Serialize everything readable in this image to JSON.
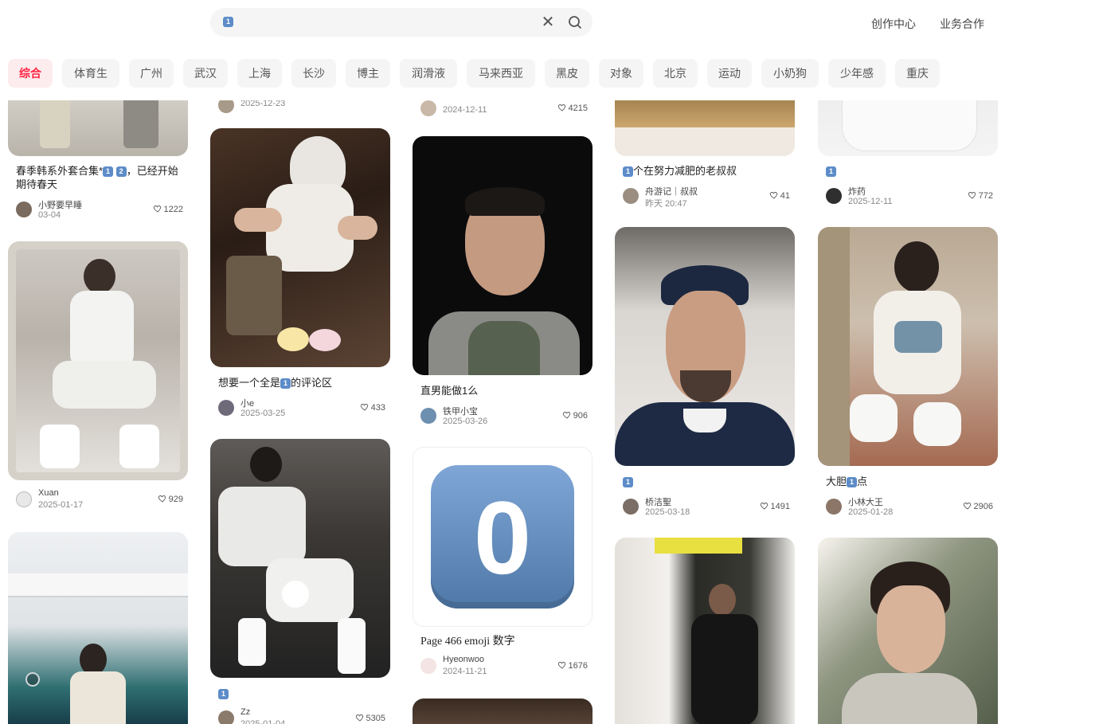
{
  "header": {
    "search_value": "1️⃣",
    "clear_icon": "close-icon",
    "search_icon": "search-icon",
    "links": [
      "创作中心",
      "业务合作"
    ]
  },
  "categories": {
    "items": [
      "综合",
      "体育生",
      "广州",
      "武汉",
      "上海",
      "长沙",
      "博主",
      "润滑液",
      "马来西亚",
      "黑皮",
      "对象",
      "北京",
      "运动",
      "小奶狗",
      "少年感",
      "重庆"
    ],
    "active": "综合"
  },
  "feed": {
    "col1": [
      {
        "title": "春季韩系外套合集*1️⃣2️⃣，已经开始期待春天",
        "author": "小野要早睡",
        "date": "03-04",
        "likes": "1222"
      },
      {
        "title": "",
        "author": "Xuan",
        "date": "2025-01-17",
        "likes": "929"
      },
      {
        "title": "",
        "author": "",
        "date": "",
        "likes": ""
      }
    ],
    "col2": [
      {
        "title": "",
        "author": "",
        "date": "2025-12-23",
        "likes": ""
      },
      {
        "title": "想要一个全是1️⃣的评论区",
        "author": "小e",
        "date": "2025-03-25",
        "likes": "433"
      },
      {
        "title": "1️⃣",
        "author": "Zz",
        "date": "2025-01-04",
        "likes": "5305"
      }
    ],
    "col3": [
      {
        "title": "",
        "author": "",
        "date": "2024-12-11",
        "likes": "4215"
      },
      {
        "title": "直男能做1么",
        "author": "铁甲小宝",
        "date": "2025-03-26",
        "likes": "906"
      },
      {
        "title": "Page 466 emoji 数字",
        "author": "Hyeonwoo",
        "date": "2024-11-21",
        "likes": "1676"
      }
    ],
    "col4": [
      {
        "title": "1️⃣个在努力减肥的老叔叔",
        "author": "舟游记｜叔叔",
        "date": "昨天 20:47",
        "likes": "41"
      },
      {
        "title": "1️⃣",
        "author": "桥洁聖",
        "date": "2025-03-18",
        "likes": "1491"
      }
    ],
    "col5": [
      {
        "title": "1️⃣",
        "author": "炸药",
        "date": "2025-12-11",
        "likes": "772"
      },
      {
        "title": "大胆1️⃣点",
        "author": "小林大王",
        "date": "2025-01-28",
        "likes": "2906"
      }
    ]
  },
  "emoji_card_digit": "0",
  "colors": {
    "accent": "#ff2442",
    "chip_bg": "#f5f5f5",
    "keycap": "#5d8cc8"
  }
}
